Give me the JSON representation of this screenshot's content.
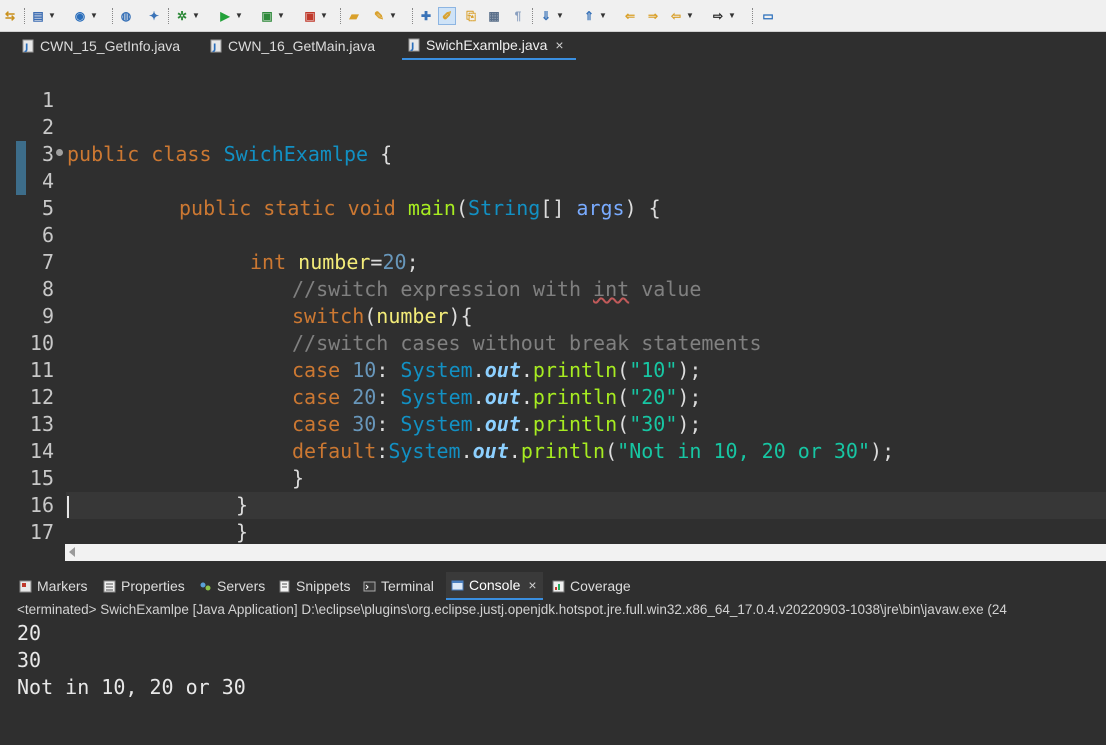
{
  "toolbar": {
    "icons": [
      "toggle-icon",
      "new-icon",
      "save-icon",
      "web-icon",
      "wand-icon",
      "debug-icon",
      "run-icon",
      "run-config-icon",
      "coverage-icon",
      "open-folder-icon",
      "brush-icon",
      "annotation-icon",
      "mark-occurrences-icon",
      "edit-icon",
      "block-icon",
      "whitespace-icon",
      "next-annotation-icon",
      "prev-annotation-icon",
      "last-edit-icon",
      "back-icon",
      "forward-icon",
      "pin-icon"
    ]
  },
  "editor_tabs": [
    {
      "label": "CWN_15_GetInfo.java"
    },
    {
      "label": "CWN_16_GetMain.java"
    },
    {
      "label": "SwichExamlpe.java",
      "close": "×"
    }
  ],
  "editor": {
    "line_numbers": [
      "1",
      "2",
      "3",
      "4",
      "5",
      "6",
      "7",
      "8",
      "9",
      "10",
      "11",
      "12",
      "13",
      "14",
      "15",
      "16",
      "17"
    ],
    "code": {
      "l2_kw1": "public",
      "l2_kw2": "class",
      "l2_class": "SwichExamlpe",
      "l2_brace": " {",
      "l4_kw1": "public",
      "l4_kw2": "static",
      "l4_kw3": "void",
      "l4_fn": "main",
      "l4_p1": "(",
      "l4_type": "String",
      "l4_p2": "[] ",
      "l4_arg": "args",
      "l4_p3": ") {",
      "l6_type": "int",
      "l6_var": "number",
      "l6_eq": "=",
      "l6_num": "20",
      "l6_semi": ";",
      "l7_cmt1": "//switch expression with ",
      "l7_cmt_int": "int",
      "l7_cmt2": " value",
      "l8_kw": "switch",
      "l8_p1": "(",
      "l8_var": "number",
      "l8_p2": "){",
      "l9_cmt": "//switch cases without break statements",
      "case_kw": "case",
      "default_kw": "default",
      "system": "System",
      "dot": ".",
      "out": "out",
      "println": "println",
      "l10_num": "10",
      "l10_str": "\"10\"",
      "l11_num": "20",
      "l11_str": "\"20\"",
      "l12_num": "30",
      "l12_str": "\"30\"",
      "l13_str": "\"Not in 10, 20 or 30\"",
      "colon": ":",
      "open_paren": "(",
      "close_semi": ");",
      "brace_close": "}"
    }
  },
  "views": {
    "tabs": [
      {
        "label": "Markers",
        "icon": "markers-icon"
      },
      {
        "label": "Properties",
        "icon": "properties-icon"
      },
      {
        "label": "Servers",
        "icon": "servers-icon"
      },
      {
        "label": "Snippets",
        "icon": "snippets-icon"
      },
      {
        "label": "Terminal",
        "icon": "terminal-icon"
      },
      {
        "label": "Console",
        "icon": "console-icon",
        "close": "×"
      },
      {
        "label": "Coverage",
        "icon": "coverage-icon"
      }
    ],
    "console_description": "<terminated> SwichExamlpe [Java Application] D:\\eclipse\\plugins\\org.eclipse.justj.openjdk.hotspot.jre.full.win32.x86_64_17.0.4.v20220903-1038\\jre\\bin\\javaw.exe  (24",
    "console_output": [
      "20",
      "30",
      "Not in 10, 20 or 30"
    ]
  },
  "colors": {
    "editor_bg": "#2f2f2f",
    "keyword": "#cc7832",
    "class": "#1290c3",
    "method": "#a7ec21",
    "string": "#17c6a3",
    "number": "#6897bb",
    "comment": "#808080",
    "static_field": "#8dd0ff"
  }
}
